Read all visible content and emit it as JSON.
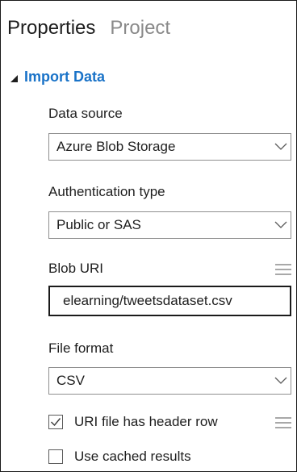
{
  "tabs": [
    {
      "label": "Properties",
      "active": true
    },
    {
      "label": "Project",
      "active": false
    }
  ],
  "section": {
    "title": "Import Data",
    "expanded": true
  },
  "fields": {
    "data_source": {
      "label": "Data source",
      "value": "Azure Blob Storage"
    },
    "authentication_type": {
      "label": "Authentication type",
      "value": "Public or SAS"
    },
    "blob_uri": {
      "label": "Blob URI",
      "value": "elearning/tweetsdataset.csv"
    },
    "file_format": {
      "label": "File format",
      "value": "CSV"
    }
  },
  "checkboxes": [
    {
      "label": "URI file has header row",
      "checked": true
    },
    {
      "label": "Use cached results",
      "checked": false
    }
  ],
  "colors": {
    "accent": "#1a73c8",
    "text": "#1e1e1e",
    "inactive_tab": "#8a8a8a",
    "border": "#8f8f8f"
  },
  "icons": [
    "expanded-triangle-icon",
    "chevron-down-icon",
    "menu-lines-icon",
    "checkmark-icon"
  ]
}
